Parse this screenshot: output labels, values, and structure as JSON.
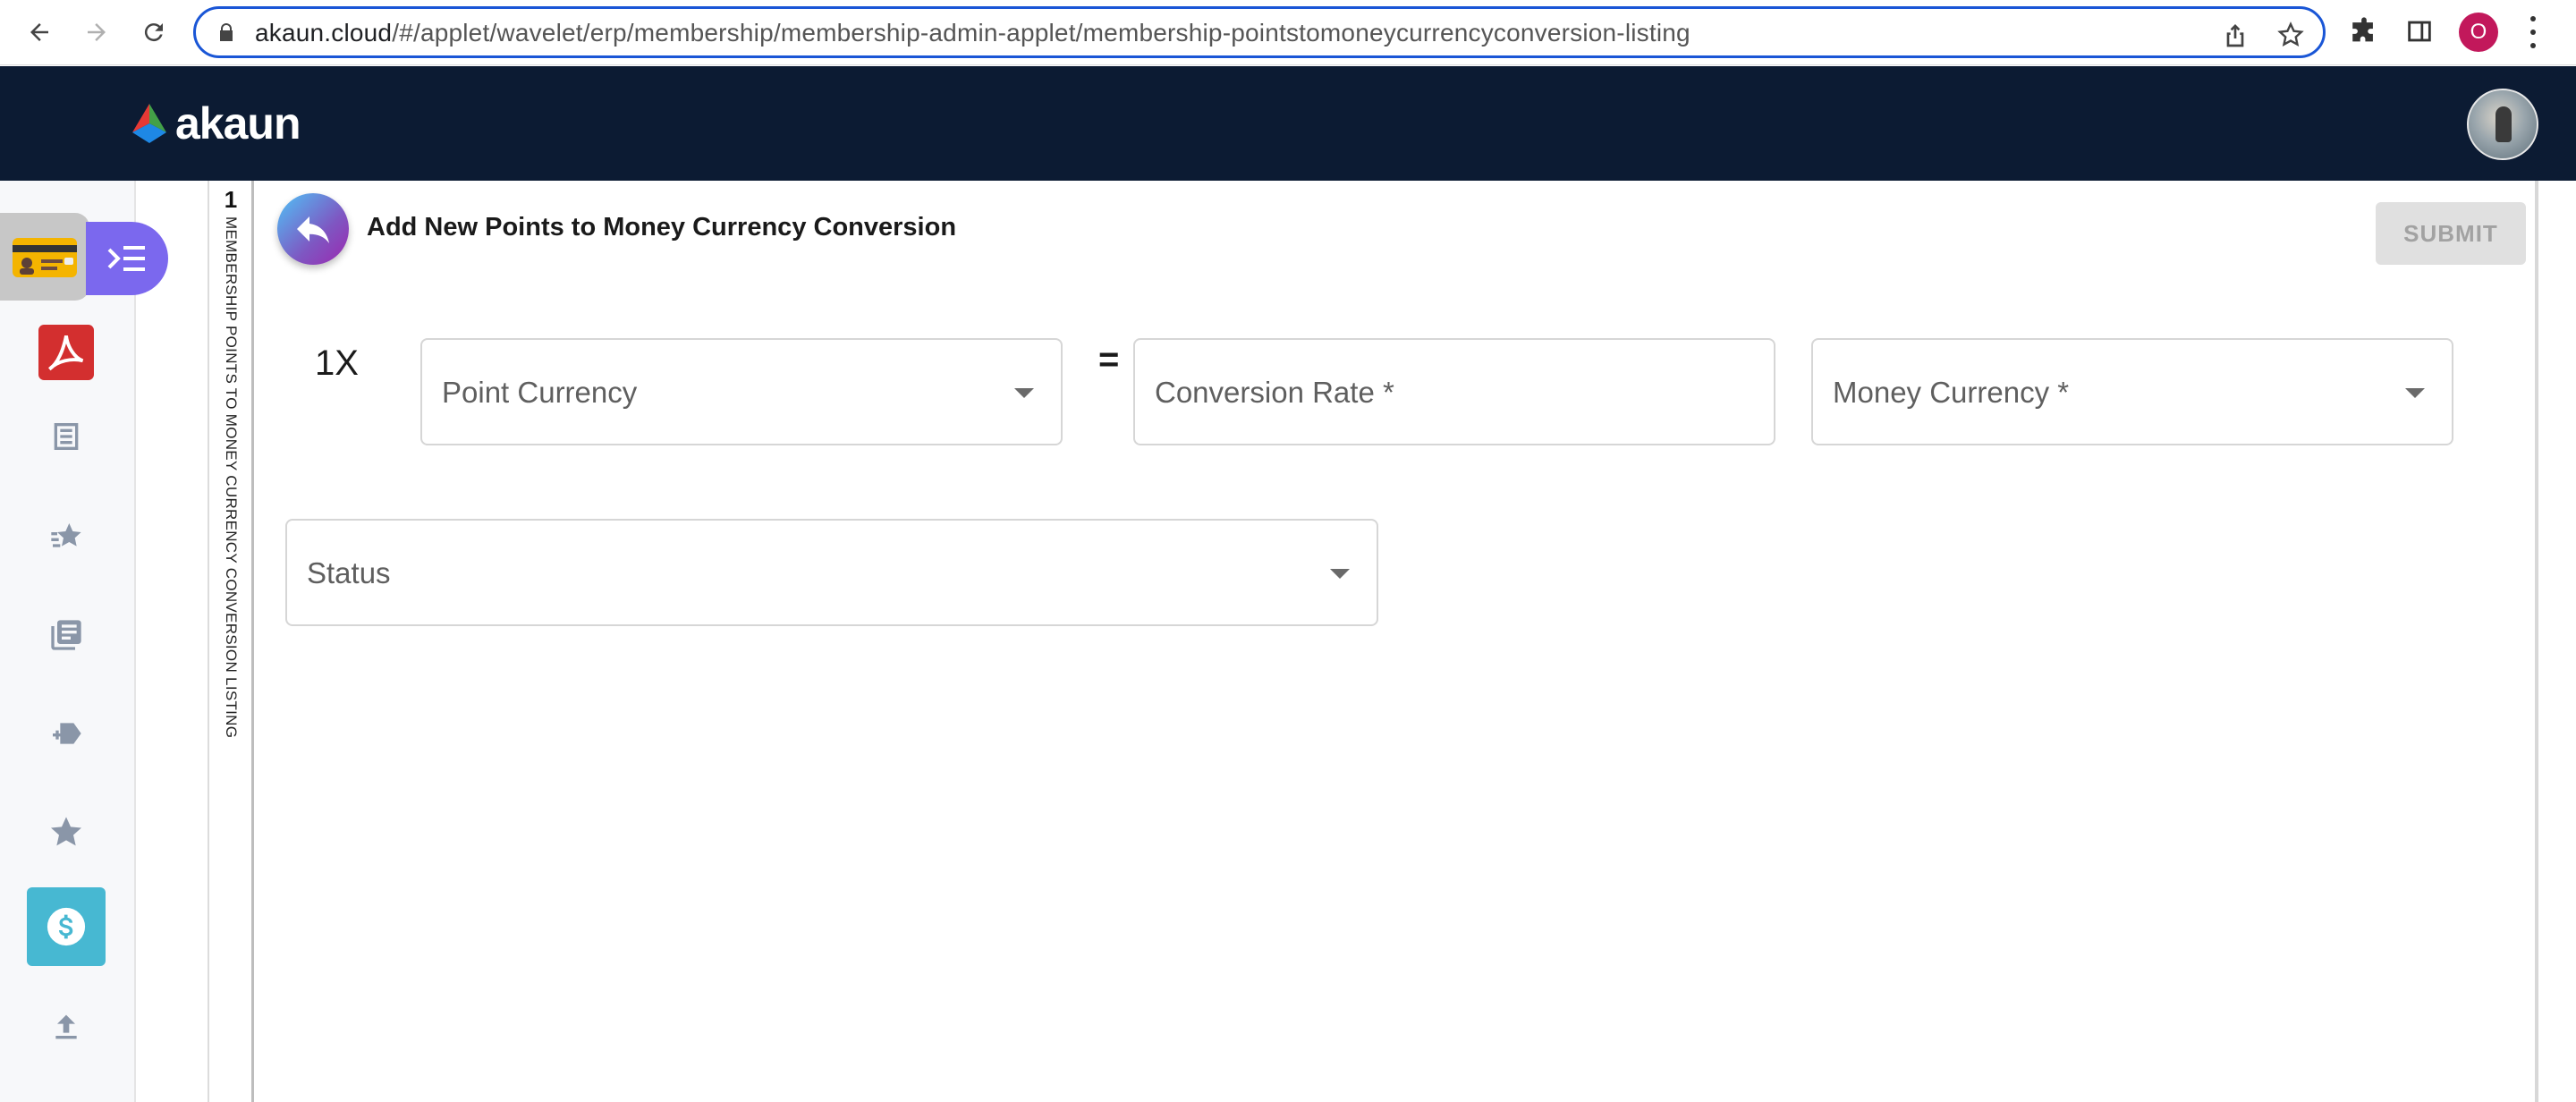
{
  "browser": {
    "url_host": "akaun.cloud",
    "url_path": "/#/applet/wavelet/erp/membership/membership-admin-applet/membership-pointstomoneycurrencyconversion-listing",
    "profile_initial": "O"
  },
  "header": {
    "brand": "akaun"
  },
  "sidebar": {
    "items": [
      {
        "icon": "membership-card-icon",
        "active": true
      },
      {
        "icon": "acrobat-icon"
      },
      {
        "icon": "list-icon"
      },
      {
        "icon": "stars-icon"
      },
      {
        "icon": "library-books-icon"
      },
      {
        "icon": "add-tag-icon"
      },
      {
        "icon": "star-icon"
      },
      {
        "icon": "dollar-icon",
        "selected": true
      },
      {
        "icon": "upload-icon"
      }
    ]
  },
  "breadcrumb": {
    "level": "1",
    "label": "MEMBERSHIP POINTS TO MONEY CURRENCY CONVERSION LISTING"
  },
  "main": {
    "title": "Add New Points to Money Currency Conversion",
    "submit_label": "SUBMIT",
    "multiplier": "1X",
    "equals": "=",
    "fields": {
      "point_currency": "Point Currency",
      "conversion_rate": "Conversion Rate *",
      "money_currency": "Money Currency *",
      "status": "Status"
    }
  },
  "colors": {
    "header_bg": "#0c1b33",
    "accent_purple": "#7b68ee",
    "selected_rail": "#47b8d2",
    "omnibox_border": "#1a56d6"
  }
}
